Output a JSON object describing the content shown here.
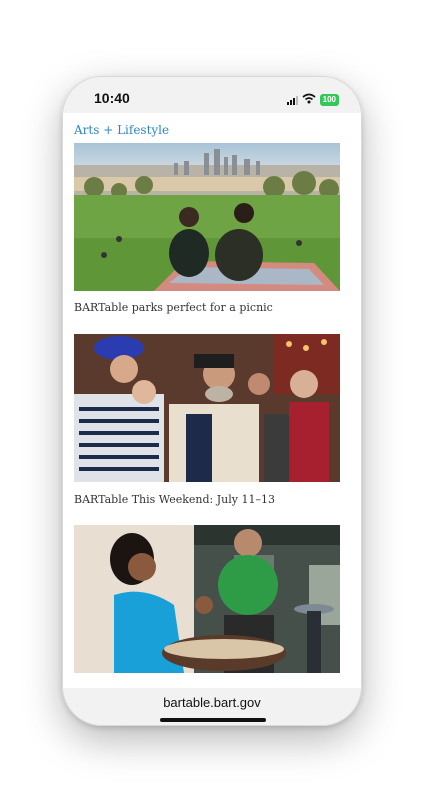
{
  "status_bar": {
    "time": "10:40",
    "battery": "100"
  },
  "section": {
    "label": "Arts + Lifestyle"
  },
  "articles": [
    {
      "title": "BARTable parks perfect for a picnic"
    },
    {
      "title": "BARTable This Weekend: July 11–13"
    },
    {
      "title": ""
    }
  ],
  "browser": {
    "url": "bartable.bart.gov"
  },
  "icons": [
    "signal-icon",
    "wifi-icon",
    "battery-icon"
  ],
  "colors": {
    "accent": "#2e86c1",
    "battery": "#34c759"
  }
}
